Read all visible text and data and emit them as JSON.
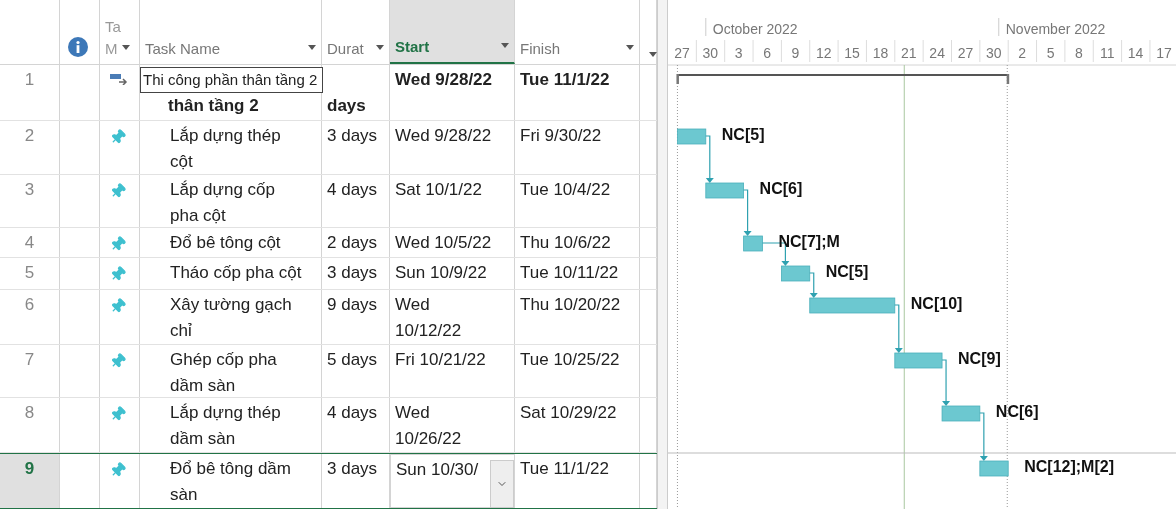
{
  "columns": [
    {
      "kind": "rownum",
      "selected": false
    },
    {
      "kind": "info",
      "selected": false
    },
    {
      "kind": "mode",
      "label": "Ta",
      "label2": "M",
      "selected": false
    },
    {
      "kind": "name",
      "label": "Task Name",
      "selected": false
    },
    {
      "kind": "duration",
      "label": "Durat",
      "selected": false
    },
    {
      "kind": "start",
      "label": "Start",
      "selected": true
    },
    {
      "kind": "finish",
      "label": "Finish",
      "selected": false
    },
    {
      "kind": "add",
      "selected": false
    }
  ],
  "timeline": {
    "months": [
      "October 2022",
      "November 2022"
    ],
    "days": [
      "27",
      "30",
      "3",
      "6",
      "9",
      "12",
      "15",
      "18",
      "21",
      "24",
      "27",
      "30",
      "2",
      "5",
      "8",
      "11",
      "14",
      "17"
    ]
  },
  "tasks": [
    {
      "id": "1",
      "kind": "summary",
      "name": "thân tầng 2",
      "name_popup": "Thi công phần thân tầng 2",
      "duration": "days",
      "start": "Wed 9/28/22",
      "finish": "Tue 11/1/22",
      "selected": false,
      "editing": false
    },
    {
      "id": "2",
      "kind": "manual",
      "name": "Lắp dựng thép cột",
      "duration": "3 days",
      "start": "Wed 9/28/22",
      "finish": "Fri 9/30/22",
      "resource": "NC[5]",
      "selected": false,
      "editing": false
    },
    {
      "id": "3",
      "kind": "manual",
      "name": "Lắp dựng cốp pha cột",
      "duration": "4 days",
      "start": "Sat 10/1/22",
      "finish": "Tue 10/4/22",
      "resource": "NC[6]",
      "selected": false,
      "editing": false
    },
    {
      "id": "4",
      "kind": "manual",
      "name": "Đổ bê tông cột",
      "duration": "2 days",
      "start": "Wed 10/5/22",
      "finish": "Thu 10/6/22",
      "resource": "NC[7];M",
      "selected": false,
      "editing": false
    },
    {
      "id": "5",
      "kind": "manual",
      "name": "Tháo cốp pha cột",
      "duration": "3 days",
      "start": "Sun 10/9/22",
      "finish": "Tue 10/11/22",
      "resource": "NC[5]",
      "selected": false,
      "editing": false
    },
    {
      "id": "6",
      "kind": "manual",
      "name": "Xây tường gạch chỉ",
      "duration": "9 days",
      "start": "Wed 10/12/22",
      "finish": "Thu 10/20/22",
      "resource": "NC[10]",
      "selected": false,
      "editing": false
    },
    {
      "id": "7",
      "kind": "manual",
      "name": "Ghép cốp pha dầm sàn",
      "duration": "5 days",
      "start": "Fri 10/21/22",
      "finish": "Tue 10/25/22",
      "resource": "NC[9]",
      "selected": false,
      "editing": false
    },
    {
      "id": "8",
      "kind": "manual",
      "name": "Lắp dựng thép dầm sàn",
      "duration": "4 days",
      "start": "Wed 10/26/22",
      "finish": "Sat 10/29/22",
      "resource": "NC[6]",
      "selected": false,
      "editing": false
    },
    {
      "id": "9",
      "kind": "manual",
      "name": "Đổ bê tông dầm sàn",
      "duration": "3 days",
      "start": "Sun 10/30/",
      "finish": "Tue 11/1/22",
      "resource": "NC[12];M[2]",
      "selected": true,
      "editing": true
    }
  ]
}
